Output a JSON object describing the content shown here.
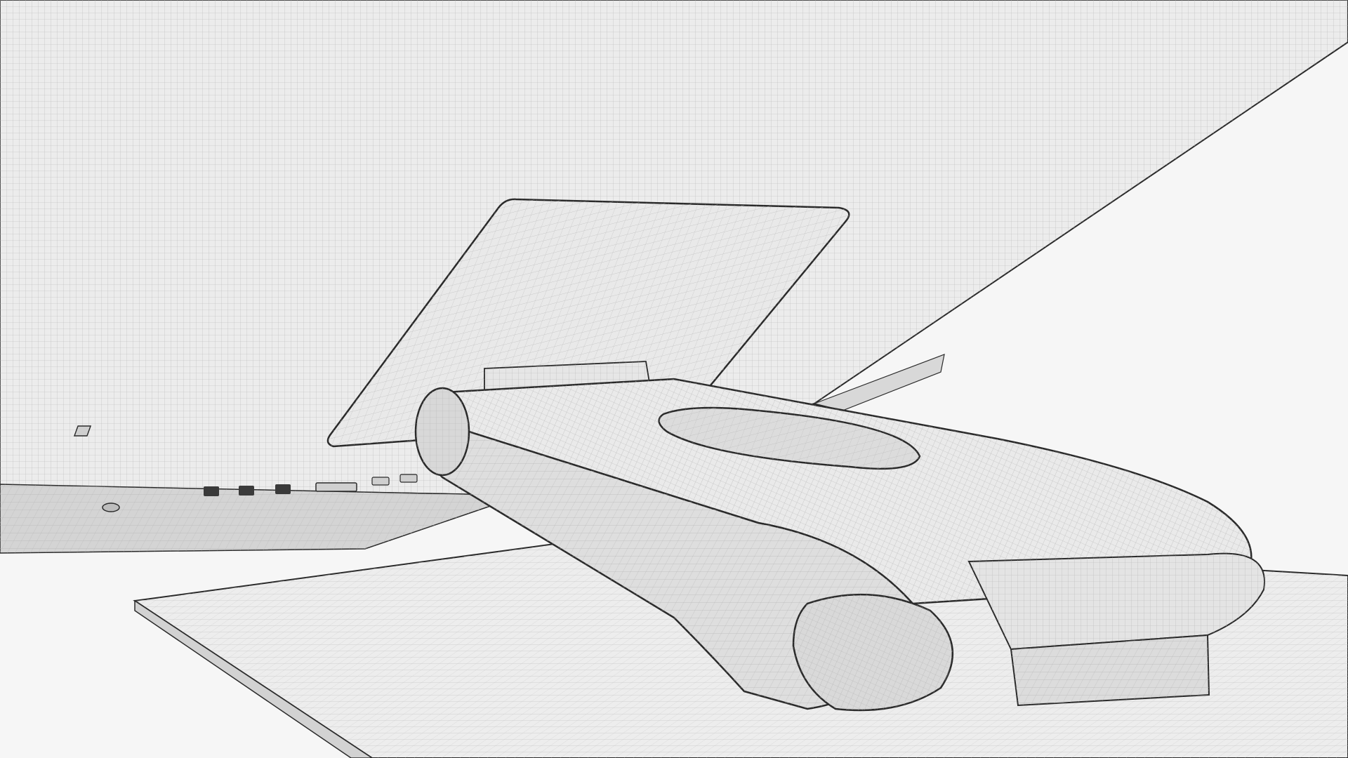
{
  "scene": {
    "subject": "monitor-stand-wireframe",
    "colors": {
      "background": "#f6f6f6",
      "monitor_surface": "#ececec",
      "monitor_edge": "#d4d4d4",
      "panel_surface": "#e9e9e9",
      "base_surface": "#ededed",
      "base_edge": "#d2d2d2",
      "arm_top": "#eaeaea",
      "arm_side": "#dedede",
      "arm_cap": "#d8d8d8",
      "wire": "#b9b9b9",
      "outline": "#2a2a2a",
      "port_dark": "#3a3a3a"
    }
  }
}
